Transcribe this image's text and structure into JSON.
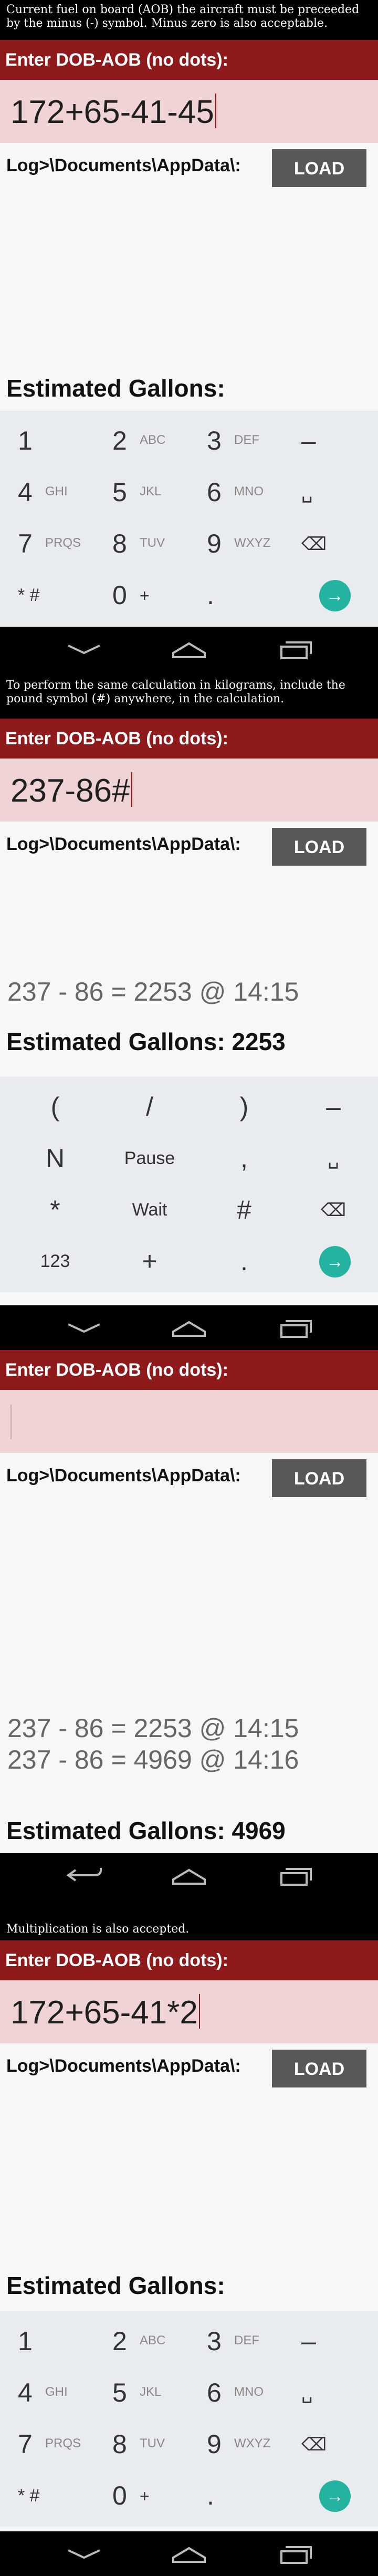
{
  "captions": [
    "Current fuel on board (AOB) the aircraft must be preceeded by the minus (-) symbol. Minus zero is also acceptable.",
    "To perform the same calculation in kilograms, include the pound symbol (#) anywhere, in the calculation.",
    "Multiplication is also accepted."
  ],
  "app": {
    "header": "Enter DOB-AOB (no dots):",
    "path_label": "Log>\\Documents\\AppData\\:",
    "load_button": "LOAD",
    "gallons_label": "Estimated Gallons:"
  },
  "screens": [
    {
      "input": "172+65-41-45",
      "history": [],
      "gallons": ""
    },
    {
      "input": "237-86#",
      "history": [
        "237 - 86 = 2253 @ 14:15"
      ],
      "gallons": "2253"
    },
    {
      "input": "",
      "history": [
        "237 - 86 = 2253 @ 14:15",
        "237 - 86 = 4969 @ 14:16"
      ],
      "gallons": "4969"
    },
    {
      "input": "172+65-41*2",
      "history": [],
      "gallons": ""
    }
  ],
  "keypad_numeric": [
    [
      {
        "n": "1",
        "l": ""
      },
      {
        "n": "2",
        "l": "ABC"
      },
      {
        "n": "3",
        "l": "DEF"
      },
      {
        "n": "–",
        "l": ""
      }
    ],
    [
      {
        "n": "4",
        "l": "GHI"
      },
      {
        "n": "5",
        "l": "JKL"
      },
      {
        "n": "6",
        "l": "MNO"
      },
      {
        "n": "␣",
        "l": ""
      }
    ],
    [
      {
        "n": "7",
        "l": "PRQS"
      },
      {
        "n": "8",
        "l": "TUV"
      },
      {
        "n": "9",
        "l": "WXYZ"
      },
      {
        "n": "⌫",
        "l": ""
      }
    ],
    [
      {
        "n": "* #",
        "l": ""
      },
      {
        "n": "0",
        "l": "+"
      },
      {
        "n": ".",
        "l": ""
      },
      {
        "n": "→",
        "l": ""
      }
    ]
  ],
  "keypad_symbols": [
    [
      "(",
      "/",
      ")",
      "–"
    ],
    [
      "N",
      "Pause",
      ",",
      "␣"
    ],
    [
      "*",
      "Wait",
      "#",
      "⌫"
    ],
    [
      "123",
      "+",
      ".",
      "→"
    ]
  ],
  "nav": {
    "back": "back-chevron",
    "home": "home",
    "recents": "recents"
  }
}
